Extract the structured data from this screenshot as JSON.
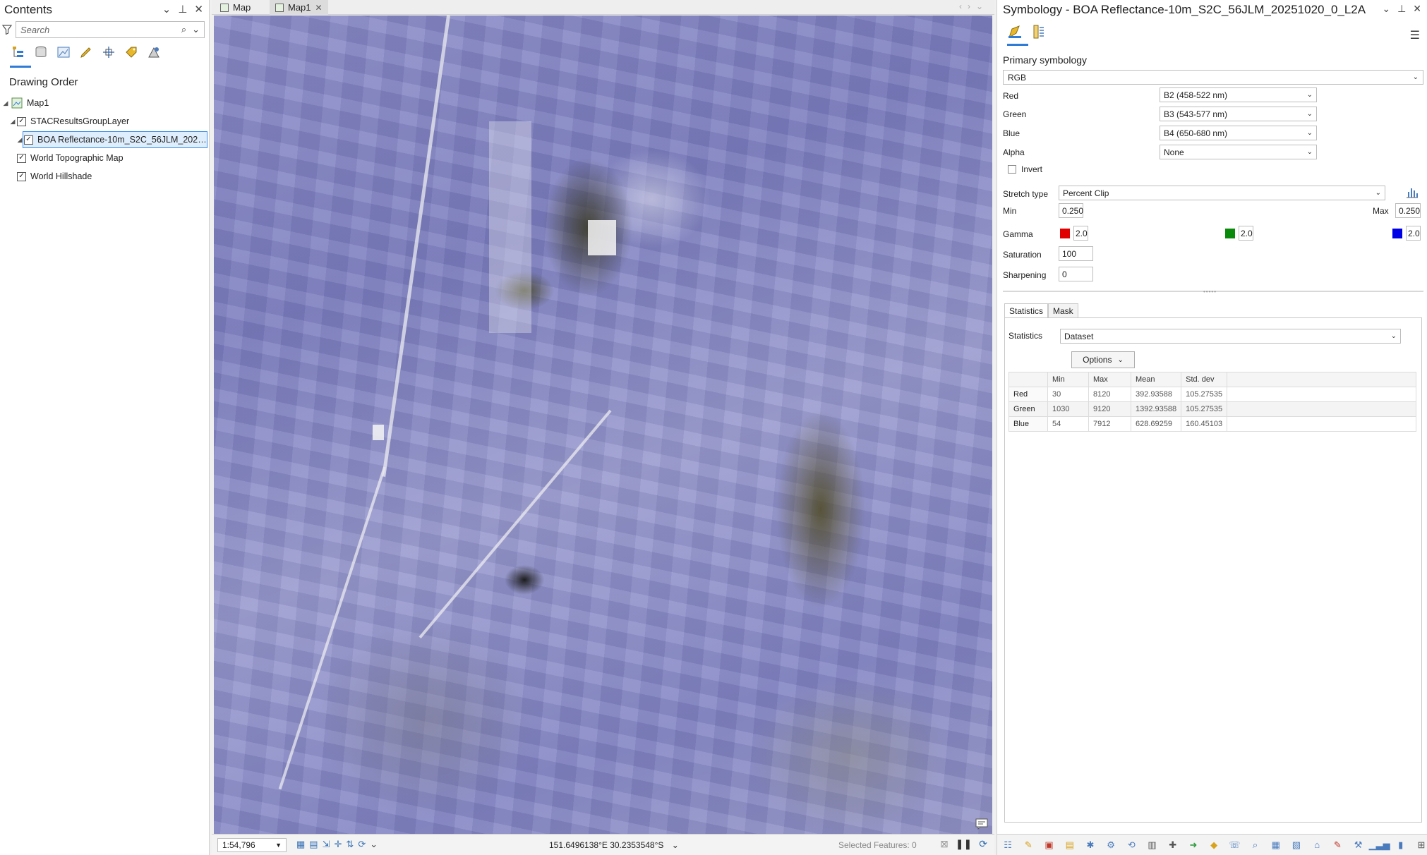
{
  "contents": {
    "title": "Contents",
    "search_placeholder": "Search",
    "drawing_order_label": "Drawing Order",
    "tree": [
      {
        "label": "Map1",
        "checked": null,
        "level": 0
      },
      {
        "label": "STACResultsGroupLayer",
        "checked": true,
        "level": 1
      },
      {
        "label": "BOA Reflectance-10m_S2C_56JLM_2025102...",
        "checked": true,
        "level": 2,
        "selected": true
      },
      {
        "label": "World Topographic Map",
        "checked": true,
        "level": 1
      },
      {
        "label": "World Hillshade",
        "checked": true,
        "level": 1
      }
    ]
  },
  "map": {
    "tabs": [
      {
        "label": "Map",
        "active": false
      },
      {
        "label": "Map1",
        "active": true
      }
    ],
    "scale": "1:54,796",
    "coordinates": "151.6496138°E 30.2353548°S",
    "selected_features": "Selected Features: 0"
  },
  "symbology": {
    "title": "Symbology - BOA Reflectance-10m_S2C_56JLM_20251020_0_L2A",
    "primary_label": "Primary symbology",
    "primary_value": "RGB",
    "red_label": "Red",
    "red_value": "B2 (458-522 nm)",
    "green_label": "Green",
    "green_value": "B3 (543-577 nm)",
    "blue_label": "Blue",
    "blue_value": "B4 (650-680 nm)",
    "alpha_label": "Alpha",
    "alpha_value": "None",
    "invert_label": "Invert",
    "stretch_label": "Stretch type",
    "stretch_value": "Percent Clip",
    "min_label": "Min",
    "min_value": "0.250",
    "max_label": "Max",
    "max_value": "0.250",
    "gamma_label": "Gamma",
    "gamma_red": "2.0",
    "gamma_green": "2.0",
    "gamma_blue": "2.0",
    "saturation_label": "Saturation",
    "saturation_value": "100",
    "sharpening_label": "Sharpening",
    "sharpening_value": "0",
    "tabs": [
      "Statistics",
      "Mask"
    ],
    "statistics_label": "Statistics",
    "statistics_value": "Dataset",
    "options_label": "Options",
    "table": {
      "headers": [
        "",
        "Min",
        "Max",
        "Mean",
        "Std. dev",
        ""
      ],
      "rows": [
        [
          "Red",
          "30",
          "8120",
          "392.93588",
          "105.27535",
          ""
        ],
        [
          "Green",
          "1030",
          "9120",
          "1392.93588",
          "105.27535",
          ""
        ],
        [
          "Blue",
          "54",
          "7912",
          "628.69259",
          "160.45103",
          ""
        ]
      ]
    }
  },
  "colors": {
    "accent": "#2f7bd6",
    "gamma_red": "#e00000",
    "gamma_green": "#0a8a0a",
    "gamma_blue": "#0000e6"
  }
}
